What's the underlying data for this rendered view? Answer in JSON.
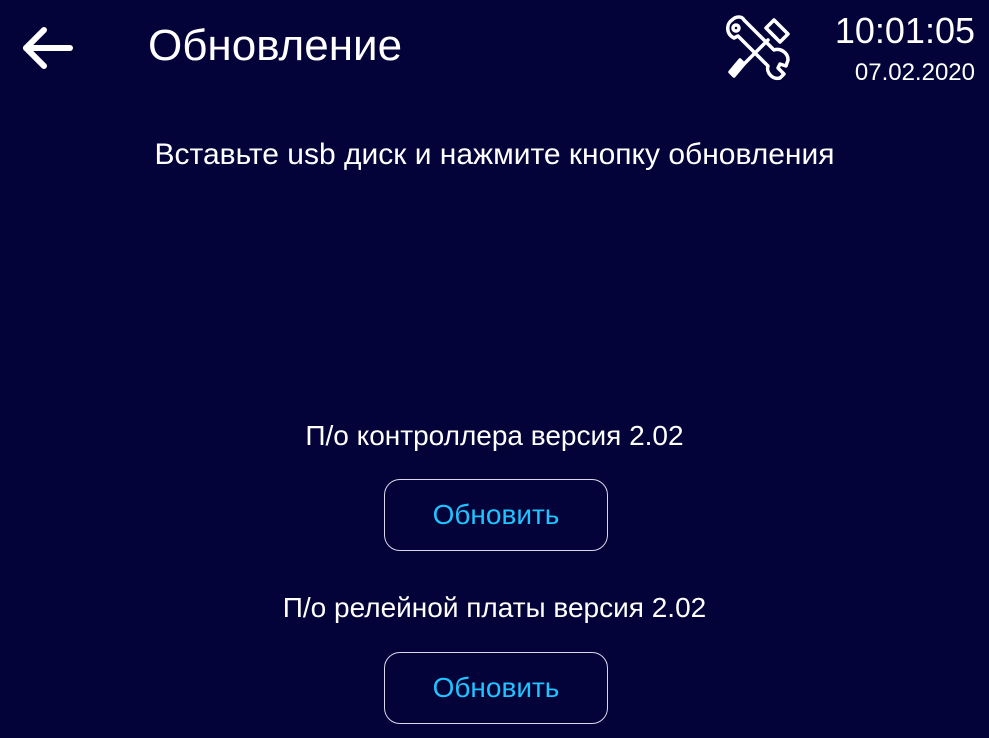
{
  "header": {
    "back_icon": "arrow-left-icon",
    "title": "Обновление",
    "tools_icon": "tools-icon",
    "time": "10:01:05",
    "date": "07.02.2020"
  },
  "main": {
    "instruction": "Вставьте usb диск и нажмите кнопку обновления",
    "sections": [
      {
        "label": "П/о контроллера версия 2.02",
        "button_label": "Обновить"
      },
      {
        "label": "П/о релейной платы версия 2.02",
        "button_label": "Обновить"
      }
    ]
  },
  "colors": {
    "background": "#03033a",
    "text": "#ffffff",
    "button_text": "#1ec3ff",
    "button_border": "#d8d8e8"
  }
}
